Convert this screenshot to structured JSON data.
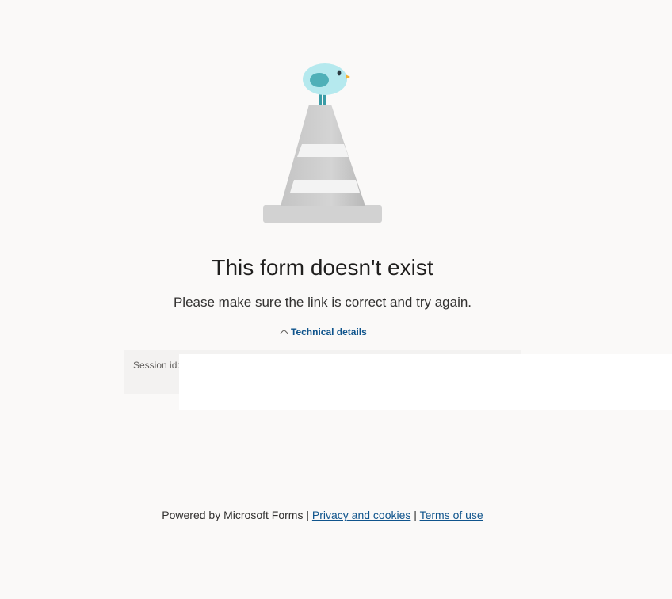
{
  "error": {
    "title": "This form doesn't exist",
    "message": "Please make sure the link is correct and try again."
  },
  "technical_details": {
    "toggle_label": "Technical details",
    "toggle_icon": "chevron-up-icon",
    "session_label": "Session id:",
    "session_value": ""
  },
  "footer": {
    "powered_by": "Powered by Microsoft Forms",
    "separator": "|",
    "privacy_link": "Privacy and cookies",
    "terms_link": "Terms of use"
  },
  "colors": {
    "background": "#faf9f8",
    "link": "#0f548c",
    "panel": "#f3f2f1"
  }
}
